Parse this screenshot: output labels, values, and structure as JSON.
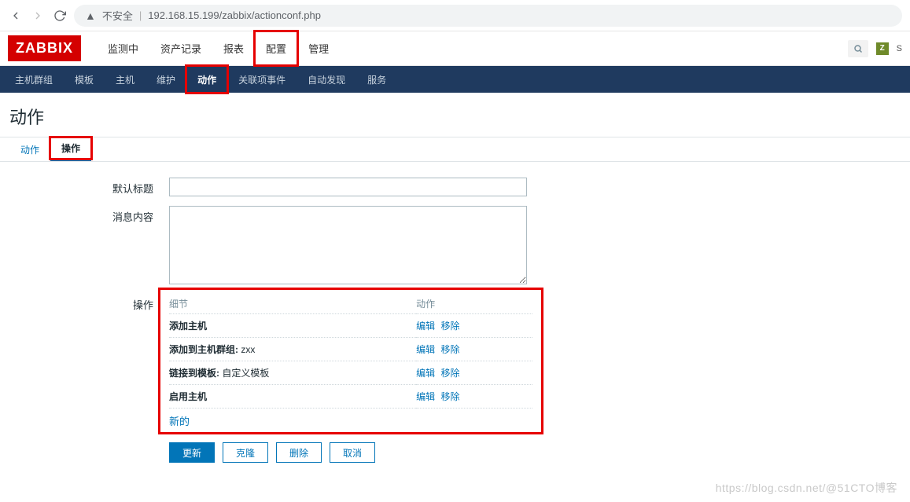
{
  "browser": {
    "insecure_label": "不安全",
    "url": "192.168.15.199/zabbix/actionconf.php"
  },
  "logo": "ZABBIX",
  "top_menu": [
    "监测中",
    "资产记录",
    "报表",
    "配置",
    "管理"
  ],
  "top_menu_active_index": 3,
  "sub_nav": [
    "主机群组",
    "模板",
    "主机",
    "维护",
    "动作",
    "关联项事件",
    "自动发现",
    "服务"
  ],
  "sub_nav_active_index": 4,
  "share_label": "S",
  "page_title": "动作",
  "tabs": [
    "动作",
    "操作"
  ],
  "tabs_active_index": 1,
  "form": {
    "default_subject_label": "默认标题",
    "default_subject_value": "",
    "message_content_label": "消息内容",
    "message_content_value": "",
    "operations_label": "操作",
    "col_details": "细节",
    "col_action": "动作",
    "edit_label": "编辑",
    "remove_label": "移除",
    "new_label": "新的",
    "rows": [
      {
        "text": "添加主机"
      },
      {
        "text_prefix": "添加到主机群组:",
        "text_suffix": " zxx"
      },
      {
        "text_prefix": "链接到模板:",
        "text_suffix": " 自定义模板"
      },
      {
        "text": "启用主机"
      }
    ]
  },
  "buttons": {
    "update": "更新",
    "clone": "克隆",
    "delete": "删除",
    "cancel": "取消"
  },
  "watermark": "https://blog.csdn.net/@51CTO博客"
}
